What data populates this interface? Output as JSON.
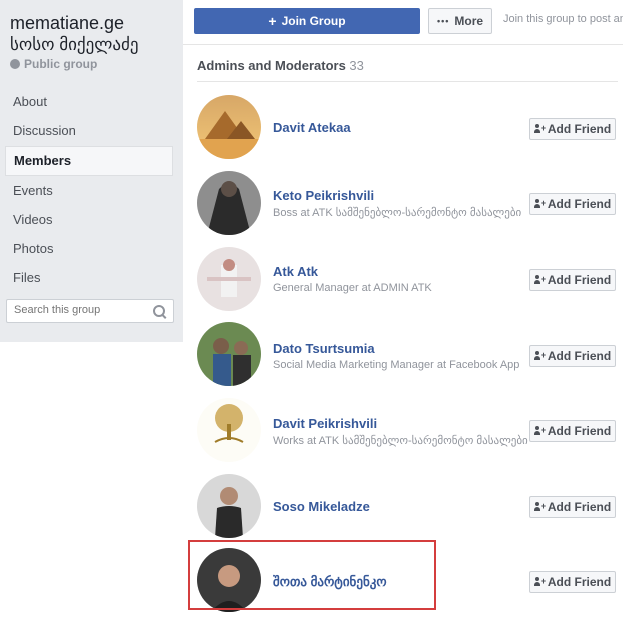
{
  "sidebar": {
    "group_name": "mematiane.ge",
    "group_name_line2": "სოსო მიქელაძე",
    "privacy": "Public group",
    "nav": [
      "About",
      "Discussion",
      "Members",
      "Events",
      "Videos",
      "Photos",
      "Files"
    ],
    "active_nav": "Members",
    "search_placeholder": "Search this group"
  },
  "topbar": {
    "join_label": "Join Group",
    "more_label": "More",
    "join_hint": "Join this group to post an"
  },
  "section": {
    "title": "Admins and Moderators",
    "count": "33"
  },
  "members": [
    {
      "name": "Davit Atekaa",
      "desc": "",
      "avatar": "pyramids"
    },
    {
      "name": "Keto Peikrishvili",
      "desc": "Boss at ATK სამშენებლო-სარემონტო მასალები",
      "avatar": "dark"
    },
    {
      "name": "Atk Atk",
      "desc": "General Manager at ADMIN ATK",
      "avatar": "light"
    },
    {
      "name": "Dato Tsurtsumia",
      "desc": "Social Media Marketing Manager at Facebook App",
      "avatar": "outdoor"
    },
    {
      "name": "Davit Peikrishvili",
      "desc": "Works at ATK სამშენებლო-სარემონტო მასალები",
      "avatar": "tree"
    },
    {
      "name": "Soso Mikeladze",
      "desc": "",
      "avatar": "man"
    },
    {
      "name": "შოთა მარტინენკო",
      "desc": "",
      "avatar": "portrait"
    }
  ],
  "add_friend_label": "Add Friend",
  "colors": {
    "link": "#365899",
    "brand": "#4267b2",
    "highlight": "#d43d3d"
  }
}
